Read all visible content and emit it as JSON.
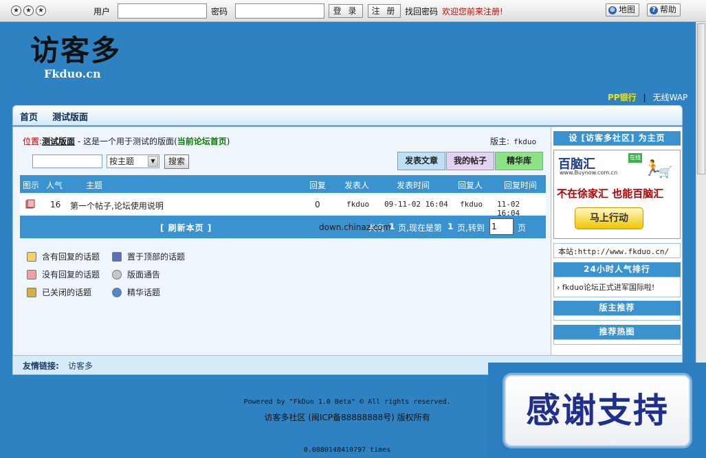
{
  "topbar": {
    "circle_icons": [
      "★",
      "★",
      "★"
    ],
    "user_label": "用户",
    "password_label": "密码",
    "login_button": "登 录",
    "register_button": "注 册",
    "find_password": "找回密码",
    "welcome": "欢迎您前来注册!",
    "map_button": "地图",
    "help_button": "帮助",
    "help_icon_char": "?",
    "map_icon_char": "⊕"
  },
  "logo": {
    "title": "访客多",
    "subtitle": "Fkduo.cn"
  },
  "top_links": {
    "pp_bank": "PP银行",
    "separator": "|",
    "wap": "无线WAP"
  },
  "nav": {
    "home": "首页",
    "forum": "测试版面"
  },
  "location": {
    "label": "位置:",
    "forum": "测试版面",
    "description": " - 这是一个用于测试的版面(",
    "home_link": "当前论坛首页",
    "close_paren": ")",
    "moderator_label": "版主:",
    "moderator_name": "fkduo"
  },
  "search": {
    "input_value": "",
    "select_value": "按主题",
    "search_button": "搜索"
  },
  "action_buttons": {
    "post": "发表文章",
    "my_posts": "我的帖子",
    "elite": "精华库"
  },
  "table": {
    "headers": [
      "图示",
      "人气",
      "主题",
      "回复",
      "发表人",
      "发表时间",
      "回复人",
      "回复时间"
    ],
    "rows": [
      {
        "hits": "16",
        "title": "第一个帖子,论坛使用说明",
        "replies": "0",
        "author": "fkduo",
        "post_time": "09-11-02 16:04",
        "replier": "fkduo",
        "reply_time": "11-02 16:04"
      }
    ]
  },
  "pager": {
    "refresh": "[ 刷新本页 ]",
    "total_prefix": "共有",
    "total_pages": "1",
    "now_text": "页,现在是第",
    "current_page": "1",
    "goto_text": "页,转到",
    "goto_value": "1",
    "page_suffix": "页",
    "overlay_url": "down.chinaz.com"
  },
  "legend": [
    {
      "label": "含有回复的话题",
      "color": "#f2d36a"
    },
    {
      "label": "置于顶部的话题",
      "color": "#5a6fb8"
    },
    {
      "label": "没有回复的话题",
      "color": "#f0a0a0"
    },
    {
      "label": "版面通告",
      "color": "#c8c8c8"
    },
    {
      "label": "已关闭的话题",
      "color": "#d8b040"
    },
    {
      "label": "精华话题",
      "color": "#4a8ad0"
    }
  ],
  "friend_links": {
    "label": "友情链接:",
    "link": "访客多"
  },
  "sidebar": {
    "set_home": "设 [访客多社区] 为主页",
    "ad": {
      "brand": "百脑汇",
      "tag": "在线",
      "site": "www.Buynow.com.cn",
      "slogan": "不在徐家汇 也能百脑汇",
      "button": "马上行动"
    },
    "site_url": "本站:http://www.fkduo.cn/",
    "hot24": "24小时人气排行",
    "hot24_item": "fkduo论坛正式进军国际啦!",
    "mod_recommend": "版主推荐",
    "hot_recommend": "推荐热图"
  },
  "footer": {
    "powered": "Powered by \"FkDuo 1.0 Beta\" © All rights reserved.",
    "site": "访客多社区 (闽ICP备88888888号) 版权所有",
    "time": "0.0880148410797 times"
  },
  "overlay": {
    "thanks": "感谢支持"
  }
}
